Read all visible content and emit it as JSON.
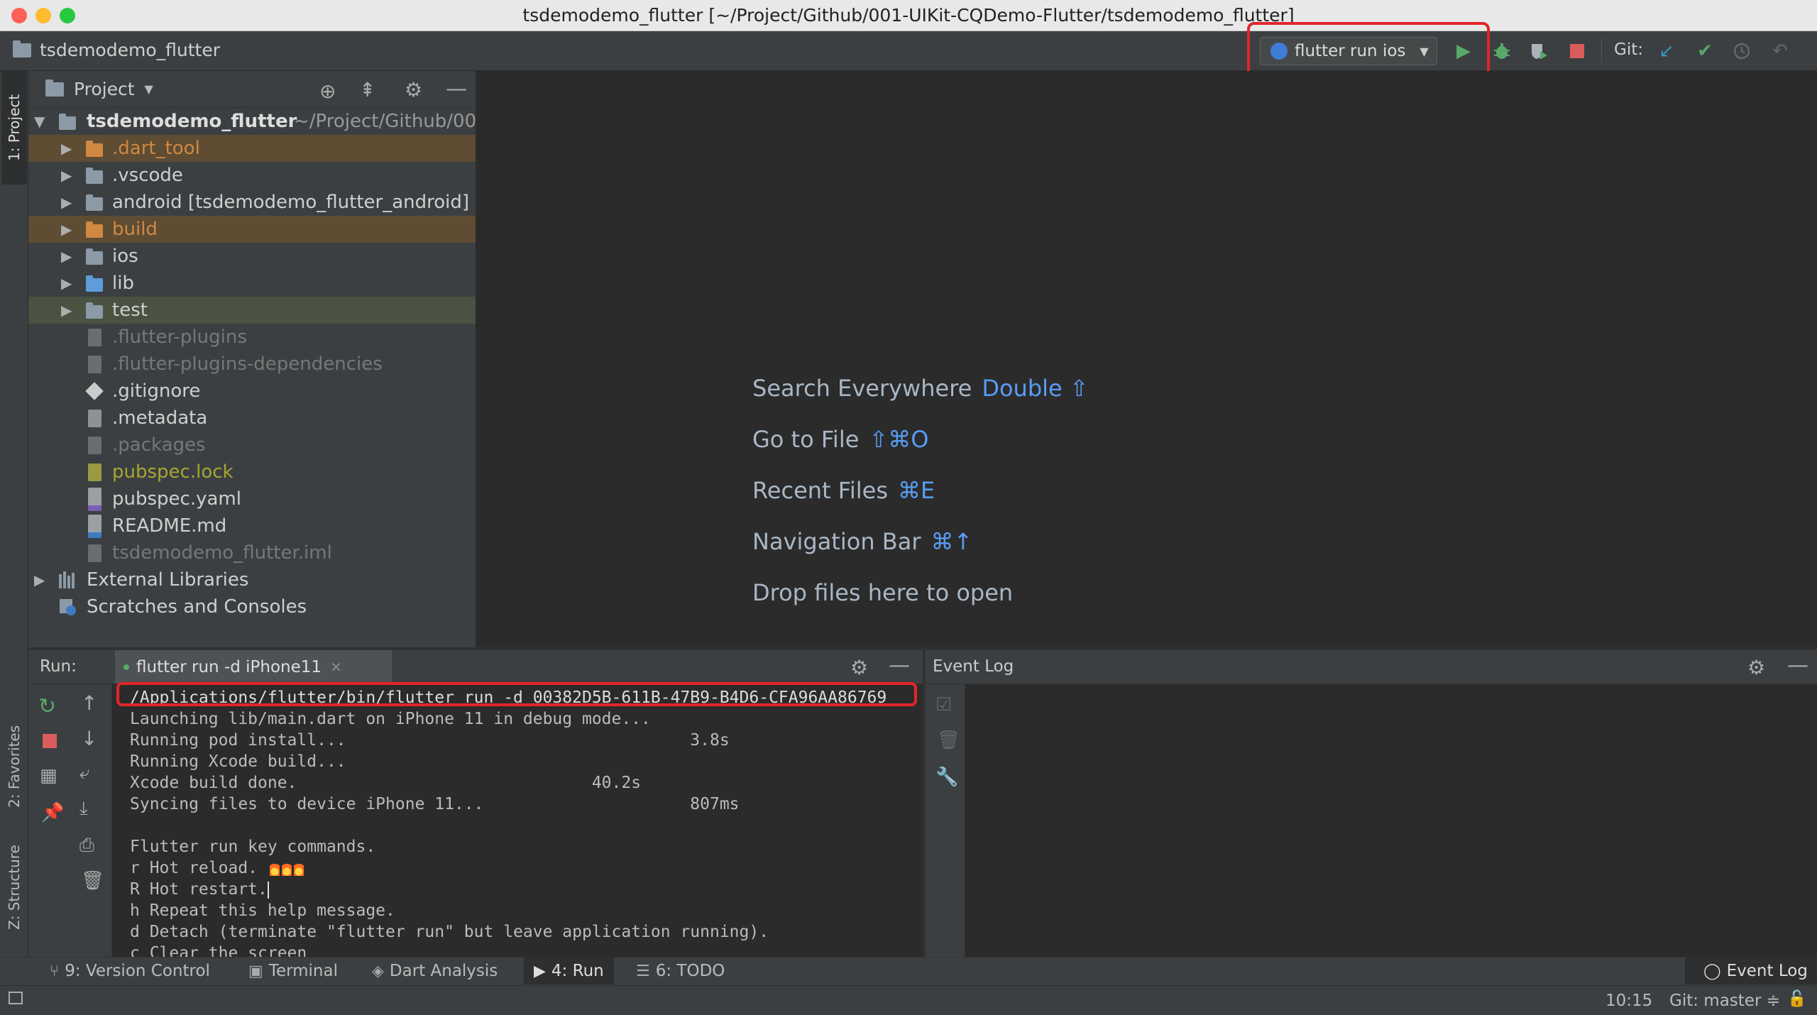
{
  "window": {
    "title": "tsdemodemo_flutter [~/Project/Github/001-UIKit-CQDemo-Flutter/tsdemodemo_flutter]"
  },
  "navbar": {
    "breadcrumb": "tsdemodemo_flutter",
    "run_config": "flutter run ios",
    "git_label": "Git:"
  },
  "left_stripe": {
    "project_tab": "1: Project",
    "favorites_tab": "2: Favorites",
    "structure_tab": "Z: Structure"
  },
  "project_panel": {
    "header": "Project",
    "root": {
      "name": "tsdemodemo_flutter",
      "path": "~/Project/Github/00"
    },
    "items": [
      {
        "label": ".dart_tool",
        "kind": "folder-excluded",
        "expandable": true
      },
      {
        "label": ".vscode",
        "kind": "folder",
        "expandable": true
      },
      {
        "label": "android [tsdemodemo_flutter_android]",
        "kind": "folder",
        "expandable": true
      },
      {
        "label": "build",
        "kind": "folder-excluded",
        "expandable": true
      },
      {
        "label": "ios",
        "kind": "folder",
        "expandable": true
      },
      {
        "label": "lib",
        "kind": "folder-source",
        "expandable": true
      },
      {
        "label": "test",
        "kind": "folder-test",
        "expandable": true
      },
      {
        "label": ".flutter-plugins",
        "kind": "file-ignored"
      },
      {
        "label": ".flutter-plugins-dependencies",
        "kind": "file-ignored"
      },
      {
        "label": ".gitignore",
        "kind": "file-git"
      },
      {
        "label": ".metadata",
        "kind": "file"
      },
      {
        "label": ".packages",
        "kind": "file-ignored"
      },
      {
        "label": "pubspec.lock",
        "kind": "file-modified"
      },
      {
        "label": "pubspec.yaml",
        "kind": "file-yaml"
      },
      {
        "label": "README.md",
        "kind": "file-md"
      },
      {
        "label": "tsdemodemo_flutter.iml",
        "kind": "file-ignored"
      }
    ],
    "external_libraries": "External Libraries",
    "scratches": "Scratches and Consoles"
  },
  "editor_hints": [
    {
      "text": "Search Everywhere",
      "key": "Double ⇧"
    },
    {
      "text": "Go to File",
      "key": "⇧⌘O"
    },
    {
      "text": "Recent Files",
      "key": "⌘E"
    },
    {
      "text": "Navigation Bar",
      "key": "⌘↑"
    },
    {
      "text": "Drop files here to open",
      "key": ""
    }
  ],
  "run_panel": {
    "label": "Run:",
    "tab": "flutter run -d iPhone11",
    "command": "/Applications/flutter/bin/flutter run -d 00382D5B-611B-47B9-B4D6-CFA96AA86769",
    "lines": [
      "Launching lib/main.dart on iPhone 11 in debug mode...",
      "Running pod install...                                   3.8s",
      "Running Xcode build...",
      "Xcode build done.                              40.2s",
      "Syncing files to device iPhone 11...                     807ms",
      "",
      "Flutter run key commands.",
      "r Hot reload.",
      "R Hot restart.",
      "h Repeat this help message.",
      "d Detach (terminate \"flutter run\" but leave application running).",
      "c Clear the screen"
    ]
  },
  "event_log": {
    "title": "Event Log"
  },
  "tool_windows": {
    "version_control": "9: Version Control",
    "terminal": "Terminal",
    "dart_analysis": "Dart Analysis",
    "run": "4: Run",
    "todo": "6: TODO",
    "event_log": "Event Log"
  },
  "status": {
    "position": "10:15",
    "branch": "Git: master ≑"
  },
  "colors": {
    "accent": "#589df6",
    "excluded_bg": "#5e4d33",
    "excluded_text": "#d08843",
    "test_bg": "#4a5242",
    "highlight": "#e3242b"
  }
}
